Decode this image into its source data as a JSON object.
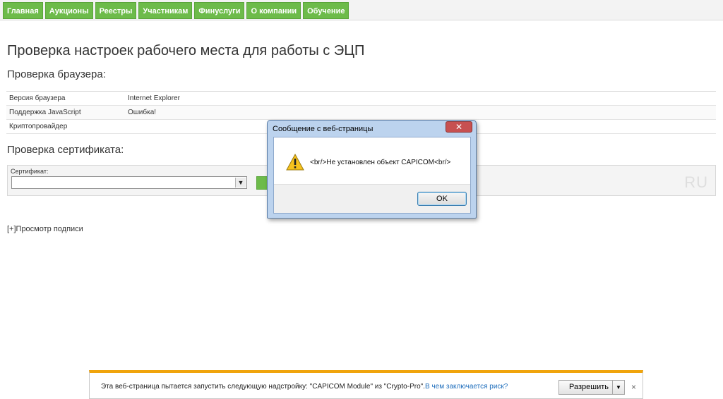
{
  "nav": {
    "items": [
      "Главная",
      "Аукционы",
      "Реестры",
      "Участникам",
      "Финуслуги",
      "О компании",
      "Обучение"
    ]
  },
  "page": {
    "title": "Проверка настроек рабочего места для работы с ЭЦП",
    "browser_section_title": "Проверка браузера:",
    "browser_rows": [
      {
        "label": "Версия браузера",
        "value": "Internet Explorer"
      },
      {
        "label": "Поддержка JavaScript",
        "value": "Ошибка!"
      },
      {
        "label": "Криптопровайдер",
        "value": ""
      }
    ],
    "cert_section_title": "Проверка сертификата:",
    "cert_label": "Сертификат:",
    "cert_value": "",
    "watermark": "RU",
    "signature_toggle": "[+]Просмотр подписи"
  },
  "dialog": {
    "title": "Сообщение с веб-страницы",
    "close_glyph": "✕",
    "message": "<br/>Не установлен объект CAPICOM<br/>",
    "ok_label": "OK",
    "icon": "warning-icon"
  },
  "notification": {
    "text": "Эта веб-страница пытается запустить следующую надстройку: \"CAPICOM Module\" из \"Crypto-Pro\".",
    "link": "В чем заключается риск?",
    "allow_label": "Разрешить",
    "dropdown_glyph": "▼",
    "close_glyph": "×"
  },
  "colors": {
    "nav_green": "#6dbb4a",
    "notify_accent": "#f0a40c",
    "link": "#1f6ebc"
  }
}
